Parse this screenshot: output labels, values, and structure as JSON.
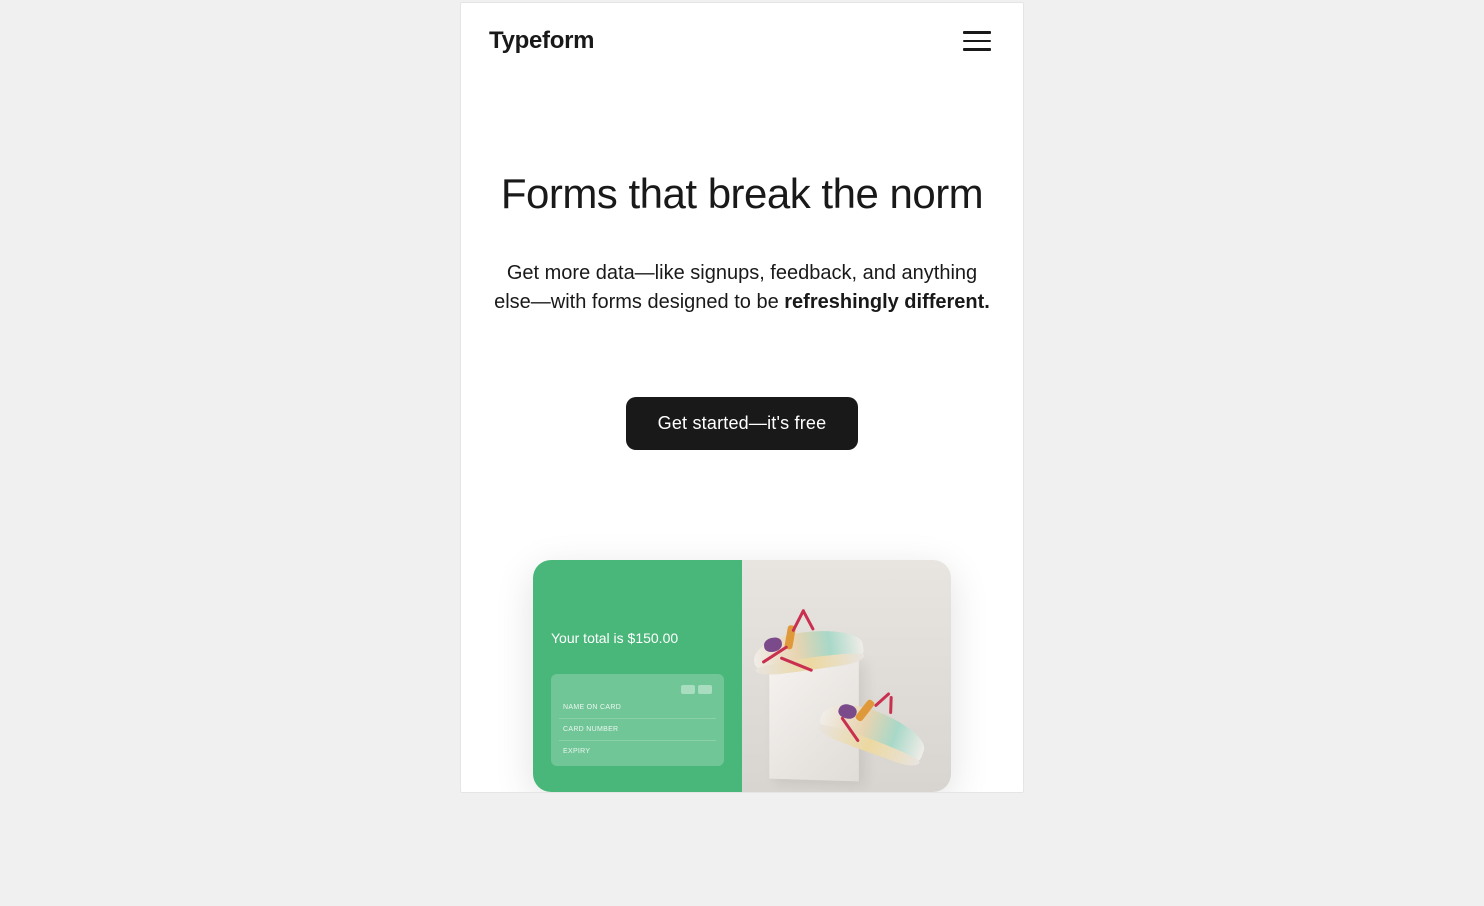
{
  "header": {
    "logo": "Typeform"
  },
  "hero": {
    "title": "Forms that break the norm",
    "subtitle_part1": "Get more data—like signups, feedback, and anything else—with forms designed to be ",
    "subtitle_strong": "refreshingly different.",
    "cta_label": "Get started—it's free"
  },
  "demo": {
    "total_text": "Your total is $150.00",
    "form_fields": {
      "name_on_card": "NAME ON CARD",
      "card_number": "CARD NUMBER",
      "expiry": "EXPIRY"
    }
  }
}
